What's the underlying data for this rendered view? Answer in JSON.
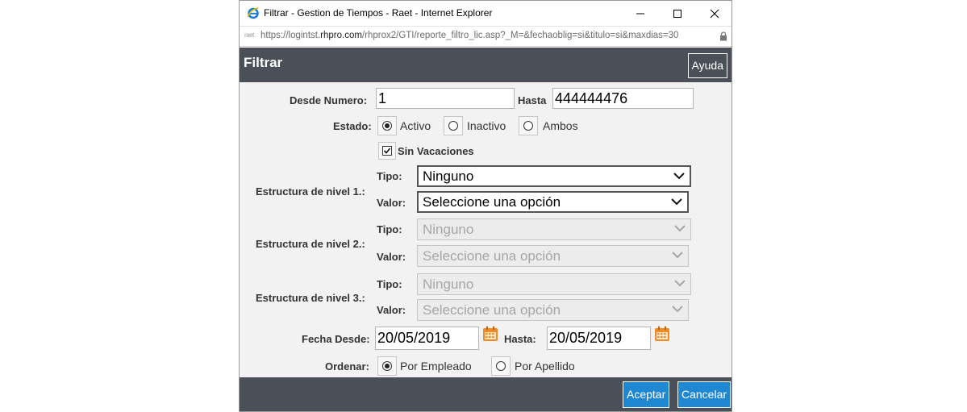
{
  "window": {
    "title": "Filtrar - Gestion de Tiempos - Raet - Internet Explorer",
    "site_icon_text": "raet",
    "url_prefix": "https://logintst.",
    "url_host": "rhpro.com",
    "url_path": "/rhprox2/GTI/reporte_filtro_lic.asp?_M=&fechaoblig=si&titulo=si&maxdias=30"
  },
  "header": {
    "title": "Filtrar",
    "help_label": "Ayuda"
  },
  "form": {
    "desde_numero_label": "Desde Numero:",
    "desde_numero_value": "1",
    "hasta_label": "Hasta",
    "hasta_value": "444444476",
    "estado_label": "Estado:",
    "estado_options": [
      "Activo",
      "Inactivo",
      "Ambos"
    ],
    "estado_selected": "Activo",
    "sin_vacaciones_label": "Sin Vacaciones",
    "sin_vacaciones_checked": true,
    "niveles": [
      {
        "label": "Estructura de nivel 1.:",
        "tipo_label": "Tipo:",
        "tipo_value": "Ninguno",
        "valor_label": "Valor:",
        "valor_value": "Seleccione una opción",
        "enabled": true
      },
      {
        "label": "Estructura de nivel 2.:",
        "tipo_label": "Tipo:",
        "tipo_value": "Ninguno",
        "valor_label": "Valor:",
        "valor_value": "Seleccione una opción",
        "enabled": false
      },
      {
        "label": "Estructura de nivel 3.:",
        "tipo_label": "Tipo:",
        "tipo_value": "Ninguno",
        "valor_label": "Valor:",
        "valor_value": "Seleccione una opción",
        "enabled": false
      }
    ],
    "fecha_desde_label": "Fecha Desde:",
    "fecha_desde_value": "20/05/2019",
    "fecha_hasta_label": "Hasta:",
    "fecha_hasta_value": "20/05/2019",
    "ordenar_label": "Ordenar:",
    "ordenar_options": [
      "Por Empleado",
      "Por Apellido"
    ],
    "ordenar_selected": "Por Empleado"
  },
  "footer": {
    "accept_label": "Aceptar",
    "cancel_label": "Cancelar"
  },
  "icons": {
    "browser": "internet-explorer-icon",
    "lock": "lock-icon",
    "calendar": "calendar-icon"
  },
  "colors": {
    "header_bg": "#4a4f58",
    "content_bg": "#f2f2f2",
    "button_blue": "#1e88d3",
    "calendar_orange": "#f08a24"
  }
}
